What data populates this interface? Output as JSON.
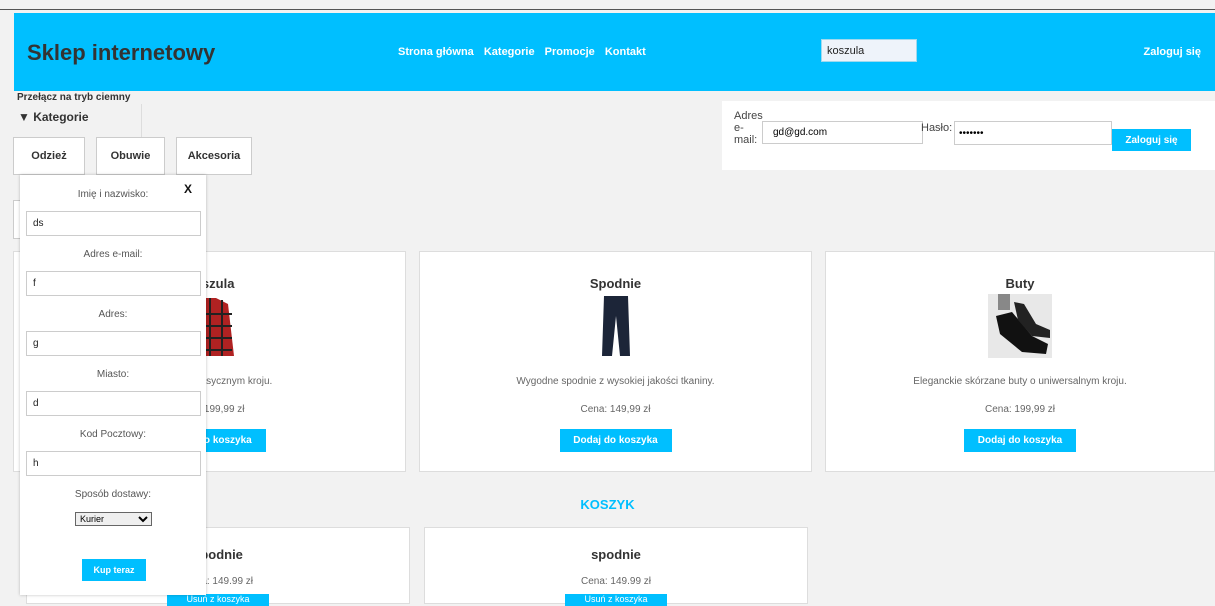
{
  "header": {
    "title": "Sklep internetowy",
    "nav": [
      "Strona główna",
      "Kategorie",
      "Promocje",
      "Kontakt"
    ],
    "search_value": "koszula",
    "login_link": "Zaloguj się"
  },
  "dark_mode_toggle": "Przełącz na tryb ciemny",
  "categories": {
    "summary": "▼ Kategorie",
    "items": [
      "Odzież",
      "Obuwie",
      "Akcesoria"
    ]
  },
  "login_form": {
    "email_label": "Adres e-mail:",
    "email_value": "gd@gd.com",
    "password_label": "Hasło:",
    "password_value": "•••••••",
    "submit_label": "Zaloguj się"
  },
  "products": [
    {
      "title": "Koszula",
      "description": "Koszula o klasycznym kroju.",
      "price": "Cena: 199,99 zł",
      "button": "Dodaj do koszyka",
      "image": "shirt-image"
    },
    {
      "title": "Spodnie",
      "description": "Wygodne spodnie z wysokiej jakości tkaniny.",
      "price": "Cena: 149,99 zł",
      "button": "Dodaj do koszyka",
      "image": "pants-image"
    },
    {
      "title": "Buty",
      "description": "Eleganckie skórzane buty o uniwersalnym kroju.",
      "price": "Cena: 199,99 zł",
      "button": "Dodaj do koszyka",
      "image": "shoes-image"
    }
  ],
  "cart": {
    "heading": "KOSZYK",
    "items": [
      {
        "title": "spodnie",
        "price": "Cena: 149.99 zł",
        "button": "Usuń z koszyka"
      },
      {
        "title": "spodnie",
        "price": "Cena: 149.99 zł",
        "button": "Usuń z koszyka"
      }
    ]
  },
  "checkout": {
    "close": "X",
    "name_label": "Imię i nazwisko:",
    "name_value": "ds",
    "email_label": "Adres e-mail:",
    "email_value": "f",
    "address_label": "Adres:",
    "address_value": "g",
    "city_label": "Miasto:",
    "city_value": "d",
    "postal_label": "Kod Pocztowy:",
    "postal_value": "h",
    "delivery_label": "Sposób dostawy:",
    "delivery_value": "Kurier",
    "buy_label": "Kup teraz"
  },
  "colors": {
    "accent": "#00bfff",
    "background": "#f2f2f2"
  }
}
